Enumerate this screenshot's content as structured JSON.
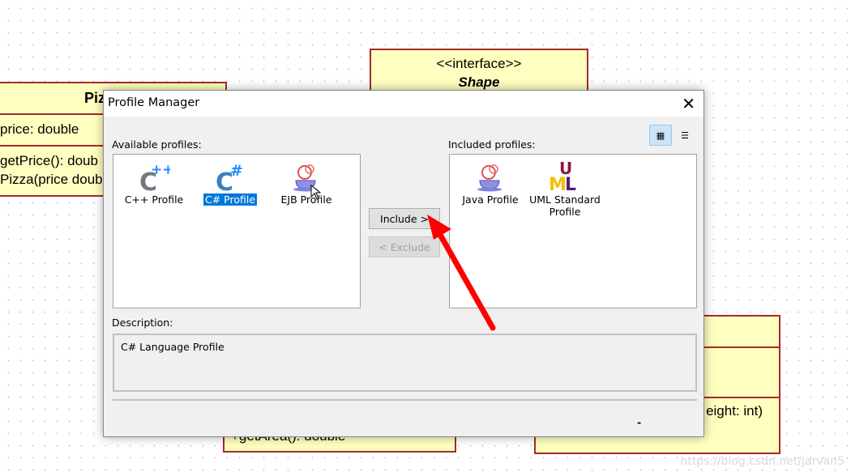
{
  "canvas": {
    "pizza": {
      "title": "Piz",
      "attr": "price: double",
      "op1": "getPrice(): doub",
      "op2": "Pizza(price doub"
    },
    "shape": {
      "stereotype": "<<interface>>",
      "name": "Shape"
    },
    "bottom_left": {
      "op": "+getArea(): double"
    },
    "bottom_right": {
      "op": "eight: int)"
    },
    "watermark": "https://blog.csdn.net/jarvan5"
  },
  "dialog": {
    "title": "Profile Manager",
    "close_icon": "close-icon",
    "available_label": "Available profiles:",
    "included_label": "Included profiles:",
    "available": [
      {
        "name": "C++ Profile",
        "icon": "cpp-icon",
        "selected": false
      },
      {
        "name": "C# Profile",
        "icon": "csharp-icon",
        "selected": true
      },
      {
        "name": "EJB Profile",
        "icon": "java-cup-icon",
        "selected": false
      }
    ],
    "included": [
      {
        "name": "Java Profile",
        "icon": "java-cup-icon"
      },
      {
        "name": "UML Standard Profile",
        "icon": "uml-icon"
      }
    ],
    "include_button": "Include >",
    "exclude_button": "< Exclude",
    "view_icons": [
      "large-icons-view-icon",
      "list-view-icon"
    ],
    "description_label": "Description:",
    "description": "C# Language Profile",
    "footer_mark": "-"
  },
  "annotation": {
    "arrow_color": "#ff0000"
  }
}
